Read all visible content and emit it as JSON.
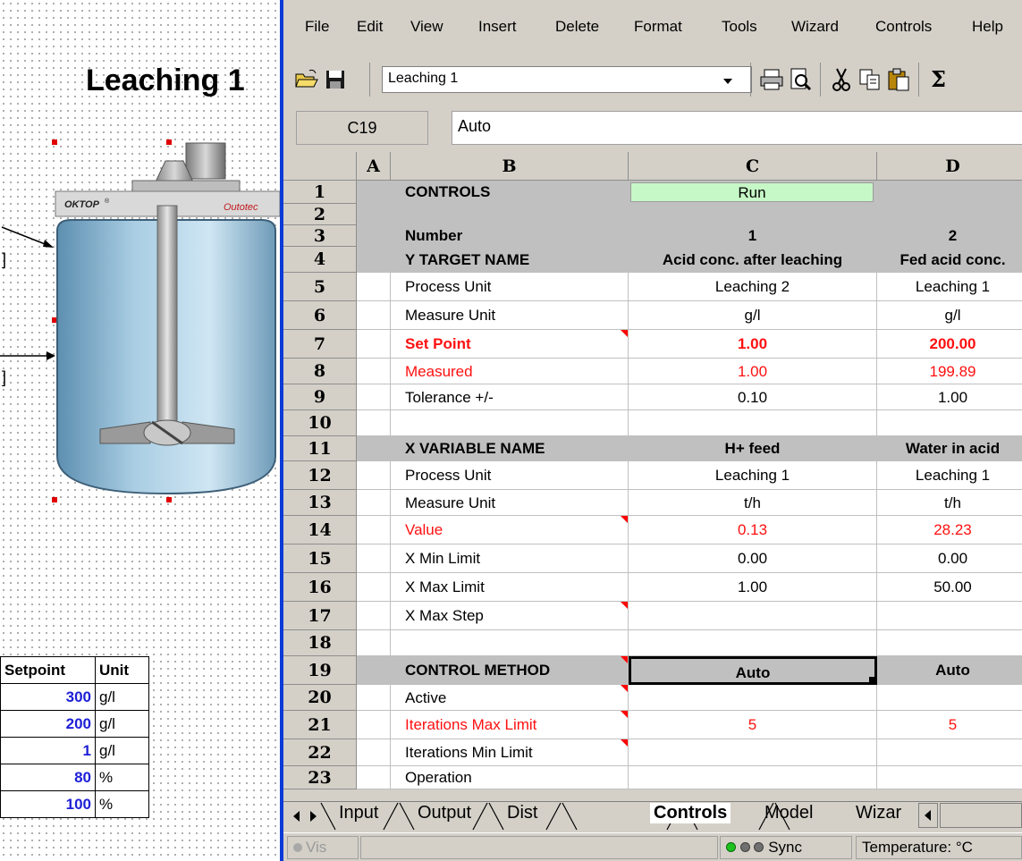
{
  "left": {
    "title": "Leaching 1",
    "tank_brand": "OKTOP",
    "tank_brand_mark": "®",
    "tank_subbrand": "Outotec",
    "setpoint_table": {
      "headers": [
        "Setpoint",
        "Unit"
      ],
      "rows": [
        {
          "value": "300",
          "unit": "g/l"
        },
        {
          "value": "200",
          "unit": "g/l"
        },
        {
          "value": "1",
          "unit": "g/l"
        },
        {
          "value": "80",
          "unit": "%"
        },
        {
          "value": "100",
          "unit": "%"
        }
      ]
    },
    "side_marks": [
      "]",
      "]"
    ]
  },
  "menu": {
    "items": [
      {
        "label": "File"
      },
      {
        "label": "Edit"
      },
      {
        "label": "View"
      },
      {
        "label": "Insert"
      },
      {
        "label": "Delete"
      },
      {
        "label": "Format"
      },
      {
        "label": "Tools"
      },
      {
        "label": "Wizard"
      },
      {
        "label": "Controls"
      },
      {
        "label": "Help"
      }
    ]
  },
  "toolbar": {
    "sheet_select": "Leaching 1",
    "sigma": "Σ"
  },
  "formula_bar": {
    "name_box": "C19",
    "value": "Auto"
  },
  "sheet": {
    "columns": [
      "A",
      "B",
      "C",
      "D"
    ],
    "rows": [
      {
        "n": "1",
        "b": "CONTROLS",
        "c": "Run",
        "d": ""
      },
      {
        "n": "2",
        "b": "",
        "c": "",
        "d": ""
      },
      {
        "n": "3",
        "b": "Number",
        "c": "1",
        "d": "2"
      },
      {
        "n": "4",
        "b": "Y TARGET NAME",
        "c": "Acid conc. after leaching",
        "d": "Fed acid conc."
      },
      {
        "n": "5",
        "b": "Process Unit",
        "c": "Leaching 2",
        "d": "Leaching 1"
      },
      {
        "n": "6",
        "b": "Measure Unit",
        "c": "g/l",
        "d": "g/l"
      },
      {
        "n": "7",
        "b": "Set Point",
        "c": "1.00",
        "d": "200.00"
      },
      {
        "n": "8",
        "b": "Measured",
        "c": "1.00",
        "d": "199.89"
      },
      {
        "n": "9",
        "b": "Tolerance +/-",
        "c": "0.10",
        "d": "1.00"
      },
      {
        "n": "10",
        "b": "",
        "c": "",
        "d": ""
      },
      {
        "n": "11",
        "b": "X VARIABLE NAME",
        "c": "H+ feed",
        "d": "Water in acid"
      },
      {
        "n": "12",
        "b": "Process Unit",
        "c": "Leaching 1",
        "d": "Leaching 1"
      },
      {
        "n": "13",
        "b": "Measure Unit",
        "c": "t/h",
        "d": "t/h"
      },
      {
        "n": "14",
        "b": "Value",
        "c": "0.13",
        "d": "28.23"
      },
      {
        "n": "15",
        "b": "X Min Limit",
        "c": "0.00",
        "d": "0.00"
      },
      {
        "n": "16",
        "b": "X Max Limit",
        "c": "1.00",
        "d": "50.00"
      },
      {
        "n": "17",
        "b": "X Max Step",
        "c": "",
        "d": ""
      },
      {
        "n": "18",
        "b": "",
        "c": "",
        "d": ""
      },
      {
        "n": "19",
        "b": "CONTROL METHOD",
        "c": "Auto",
        "d": "Auto"
      },
      {
        "n": "20",
        "b": "Active",
        "c": "",
        "d": ""
      },
      {
        "n": "21",
        "b": "Iterations Max Limit",
        "c": "5",
        "d": "5"
      },
      {
        "n": "22",
        "b": "Iterations Min Limit",
        "c": "",
        "d": ""
      },
      {
        "n": "23",
        "b": "Operation",
        "c": "",
        "d": ""
      }
    ]
  },
  "tabs": {
    "items": [
      {
        "label": "Input"
      },
      {
        "label": "Output"
      },
      {
        "label": "Dist"
      },
      {
        "label": "Controls",
        "active": true
      },
      {
        "label": "Model"
      },
      {
        "label": "Wizar"
      }
    ]
  },
  "status": {
    "vis": "Vis",
    "sync": "Sync",
    "temperature": "Temperature: °C"
  },
  "colors": {
    "divider": "#0b3ad6",
    "run_button": "#c6f7c6",
    "red_text": "#ff1010",
    "setpoint_blue": "#1e20d6",
    "section_gray": "#c0c0c0"
  }
}
